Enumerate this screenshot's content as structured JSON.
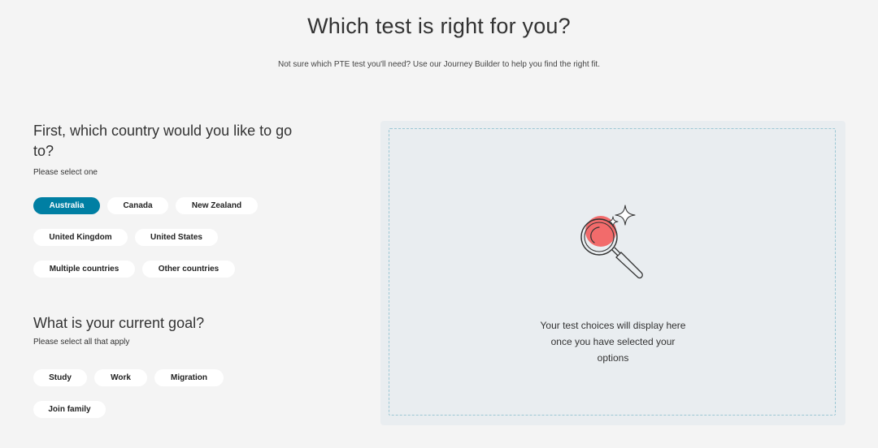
{
  "header": {
    "title": "Which test is right for you?",
    "subtitle": "Not sure which PTE test you'll need? Use our Journey Builder to help you find the right fit."
  },
  "country_question": {
    "heading": "First, which country would you like to go to?",
    "hint": "Please select one",
    "options": [
      {
        "label": "Australia",
        "selected": true
      },
      {
        "label": "Canada",
        "selected": false
      },
      {
        "label": "New Zealand",
        "selected": false
      },
      {
        "label": "United Kingdom",
        "selected": false
      },
      {
        "label": "United States",
        "selected": false
      },
      {
        "label": "Multiple countries",
        "selected": false
      },
      {
        "label": "Other countries",
        "selected": false
      }
    ]
  },
  "goal_question": {
    "heading": "What is your current goal?",
    "hint": "Please select all that apply",
    "options": [
      {
        "label": "Study",
        "selected": false
      },
      {
        "label": "Work",
        "selected": false
      },
      {
        "label": "Migration",
        "selected": false
      },
      {
        "label": "Join family",
        "selected": false
      }
    ]
  },
  "results_panel": {
    "message_lines": [
      "Your test choices will display here",
      "once you have selected your",
      "options"
    ],
    "icon": "magnifying-glass-sparkle-icon"
  },
  "colors": {
    "accent": "#007fa3",
    "background": "#f4f4f4",
    "panel": "#e9edf0",
    "panel_border": "#9cc7d4",
    "highlight": "#f26b6b"
  }
}
